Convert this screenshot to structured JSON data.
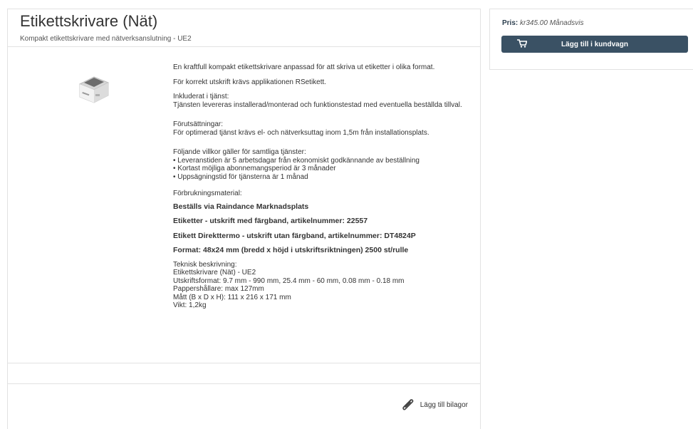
{
  "product": {
    "title": "Etikettskrivare (Nät)",
    "subtitle": "Kompakt etikettskrivare med nätverksanslutning - UE2",
    "image_icon": "label-printer-image"
  },
  "description": {
    "intro": "En kraftfull kompakt etikettskrivare anpassad för att skriva ut etiketter i olika format.",
    "app_note": "För korrekt utskrift krävs applikationen RSetikett.",
    "included_heading": "Inkluderat i tjänst:",
    "included_text": "Tjänsten levereras installerad/monterad och funktionstestad med eventuella beställda tillval.",
    "prereq_heading": "Förutsättningar:",
    "prereq_text": "För optimerad tjänst krävs el- och nätverksuttag inom 1,5m från installationsplats.",
    "terms_heading": "Följande villkor gäller för samtliga tjänster:",
    "terms": [
      "• Leveranstiden är 5 arbetsdagar från ekonomiskt godkännande av beställning",
      "• Kortast möjliga abonnemangsperiod är 3 månader",
      "• Uppsägningstid för tjänsterna är 1 månad"
    ],
    "consumables_heading": "Förbrukningsmaterial:",
    "consumables_bold": [
      "Beställs via Raindance Marknadsplats",
      "Etiketter - utskrift med färgband,  artikelnummer: 22557",
      "Etikett Direkttermo - utskrift utan färgband, artikelnummer: DT4824P",
      "Format: 48x24 mm (bredd x höjd i utskriftsriktningen) 2500 st/rulle"
    ],
    "tech_heading": "Teknisk beskrivning:",
    "tech_lines": [
      "Etikettskrivare (Nät) - UE2",
      "Utskriftsformat: 9.7 mm - 990 mm, 25.4 mm - 60 mm, 0.08 mm - 0.18 mm",
      "Pappershållare: max 127mm",
      "Mått (B x D x H): 111 x 216 x 171 mm",
      "Vikt: 1,2kg"
    ]
  },
  "footer": {
    "attach_label": "Lägg till bilagor",
    "attach_icon": "paperclip-icon"
  },
  "sidebar": {
    "price_label": "Pris:",
    "price_value": "kr345.00 Månadsvis",
    "cart_button_label": "Lägg till i kundvagn",
    "cart_icon": "cart-icon"
  }
}
